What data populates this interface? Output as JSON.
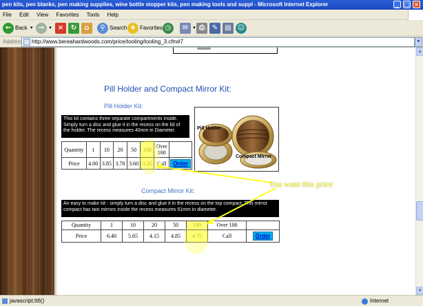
{
  "window": {
    "title": "pen kits, pen blanks, pen making supplies, wine bottle stopper kits, pen making tools and suppl - Microsoft Internet Explorer"
  },
  "menu": [
    "File",
    "Edit",
    "View",
    "Favorites",
    "Tools",
    "Help"
  ],
  "toolbar": {
    "back_label": "Back",
    "search_label": "Search",
    "favorites_label": "Favorites"
  },
  "address": {
    "label": "Address",
    "url": "http://www.bereahardwoods.com/price/tooling/tooling_3.cfm#7"
  },
  "page": {
    "section_title": "Pill Holder and Compact Mirror Kit:",
    "pill": {
      "subtitle": "Pill Holder Kit:",
      "description": "This kit contains three separate compartments inside. Simply turn a disc and glue it in the recess on the lid of the holder. The recess measures 40mm in Diameter.",
      "quantity_header": "Quantity",
      "quantities": [
        "1",
        "10",
        "20",
        "50",
        "100",
        "Over 100"
      ],
      "price_header": "Price",
      "prices": [
        "4.00",
        "3.85",
        "3.70",
        "3.60",
        "3.35",
        "Call"
      ],
      "order_label": "Order",
      "image_label_pill": "Pill Holder",
      "image_label_mirror": "Compact Mirror"
    },
    "compact": {
      "subtitle": "Compact Mirror Kit:",
      "description": "An easy to make kit - simply turn a disc and glue it in the recess on the top compact. This mirror compact has two mirrors inside the recess measures 51mm in diameter.",
      "quantity_header": "Quantity",
      "quantities": [
        "1",
        "10",
        "20",
        "50",
        "100",
        "Over 100"
      ],
      "price_header": "Price",
      "prices": [
        "6.40",
        "5.65",
        "4.15",
        "4.85",
        "4.75",
        "Call"
      ],
      "order_label": "Order"
    },
    "callout": "You want this price",
    "colors": {
      "highlight": "#ffff88",
      "callout_text": "#ffff22",
      "heading_blue": "#1f4fb3",
      "order_button": "#00aee8"
    }
  },
  "status": {
    "text": "javascript:tt6()",
    "zone": "Internet"
  },
  "icons": [
    "back-icon",
    "forward-icon",
    "stop-icon",
    "refresh-icon",
    "home-icon",
    "search-icon",
    "favorites-star-icon",
    "history-icon",
    "mail-icon",
    "print-icon",
    "edit-icon",
    "messenger-icon",
    "page-icon",
    "globe-icon"
  ]
}
